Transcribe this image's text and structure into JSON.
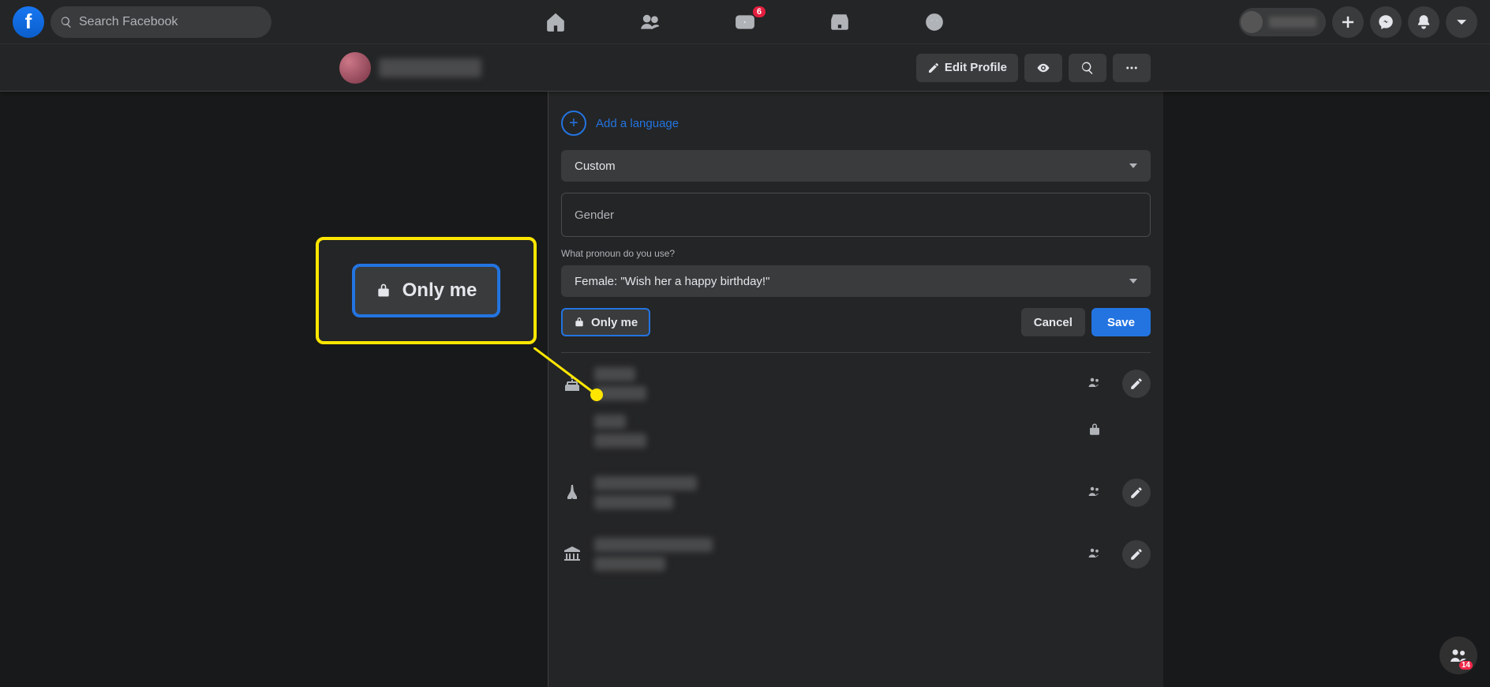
{
  "header": {
    "search_placeholder": "Search Facebook",
    "watch_badge": "6"
  },
  "profile_bar": {
    "edit_label": "Edit Profile"
  },
  "gender_section": {
    "add_language": "Add a language",
    "custom_select": "Custom",
    "gender_placeholder": "Gender",
    "pronoun_label": "What pronoun do you use?",
    "pronoun_value": "Female: \"Wish her a happy birthday!\"",
    "only_me": "Only me",
    "cancel": "Cancel",
    "save": "Save"
  },
  "callout": {
    "only_me": "Only me"
  },
  "fab_badge": "14"
}
